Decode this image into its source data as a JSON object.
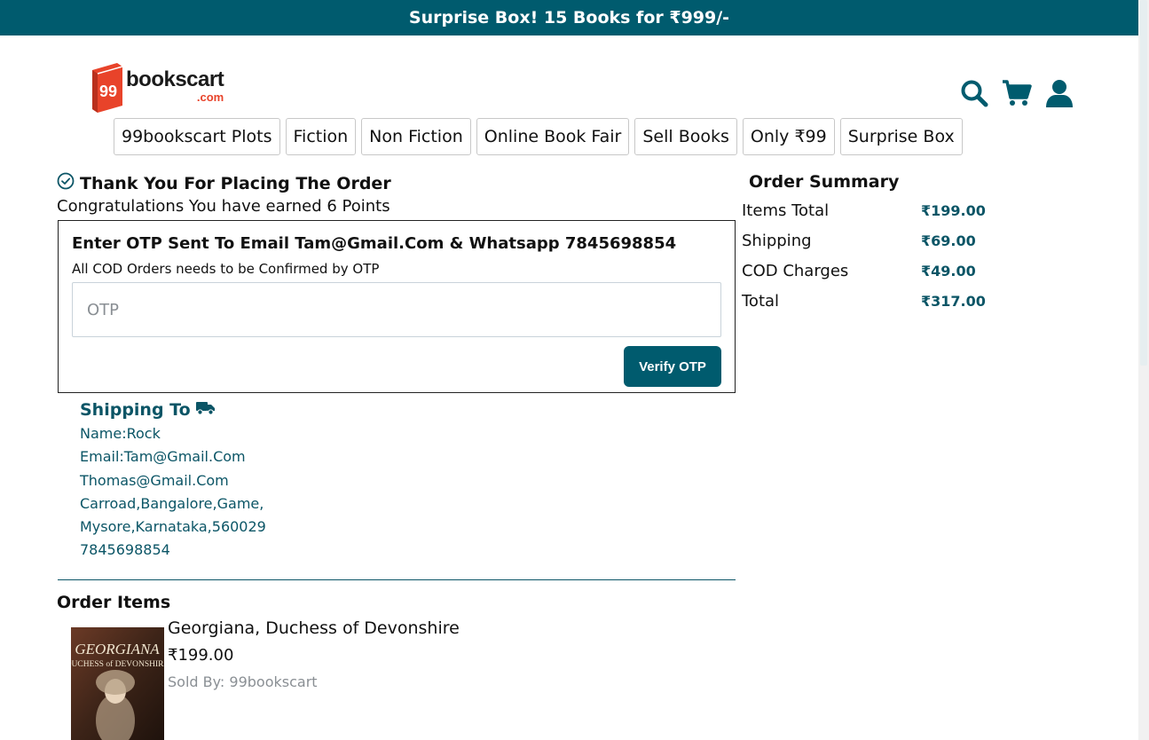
{
  "banner": {
    "text": "Surprise Box! 15 Books for ₹999/-"
  },
  "logo": {
    "number": "99",
    "name": "bookscart",
    "suffix": ".com"
  },
  "header_icons": [
    "search-icon",
    "cart-icon",
    "user-icon"
  ],
  "nav": [
    "99bookscart Plots",
    "Fiction",
    "Non Fiction",
    "Online Book Fair",
    "Sell Books",
    "Only ₹99",
    "Surprise Box"
  ],
  "order": {
    "thanks": "Thank You For Placing The Order",
    "congrats": "Congratulations You have earned 6 Points"
  },
  "otp": {
    "title": "Enter OTP Sent To Email Tam@Gmail.Com & Whatsapp 7845698854",
    "subtitle": "All COD Orders needs to be Confirmed by OTP",
    "placeholder": "OTP",
    "value": "",
    "button": "Verify OTP"
  },
  "shipping": {
    "title": "Shipping To",
    "lines": [
      "Name:Rock",
      "Email:Tam@Gmail.Com",
      "Thomas@Gmail.Com",
      "Carroad,Bangalore,Game,",
      "Mysore,Karnataka,560029",
      "7845698854"
    ]
  },
  "order_items": {
    "title": "Order Items",
    "items": [
      {
        "name": "Georgiana, Duchess of Devonshire",
        "price": "₹199.00",
        "seller": "Sold By: 99bookscart",
        "cover_title": "GEORGIANA",
        "cover_subtitle": "DUCHESS of DEVONSHIRE"
      }
    ]
  },
  "summary": {
    "title": "Order Summary",
    "rows": [
      {
        "label": "Items Total",
        "value": "₹199.00"
      },
      {
        "label": "Shipping",
        "value": "₹69.00"
      },
      {
        "label": "COD Charges",
        "value": "₹49.00"
      },
      {
        "label": "Total",
        "value": "₹317.00"
      }
    ]
  },
  "colors": {
    "primary": "#005b6e",
    "text_teal": "#0b5566",
    "logo_red": "#e8432a",
    "muted": "#8a8f94"
  }
}
